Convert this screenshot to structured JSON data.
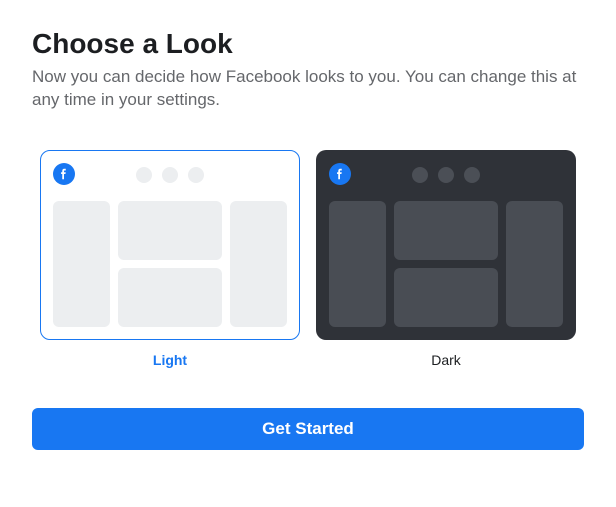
{
  "title": "Choose a Look",
  "subtitle": "Now you can decide how Facebook looks to you. You can change this at any time in your settings.",
  "options": {
    "light": {
      "label": "Light",
      "selected": true
    },
    "dark": {
      "label": "Dark",
      "selected": false
    }
  },
  "cta_label": "Get Started",
  "icons": {
    "facebook": "facebook-icon"
  },
  "colors": {
    "accent": "#1877f2",
    "light_bg": "#ffffff",
    "light_block": "#eceef0",
    "dark_bg": "#2f3238",
    "dark_block": "#494d54"
  }
}
